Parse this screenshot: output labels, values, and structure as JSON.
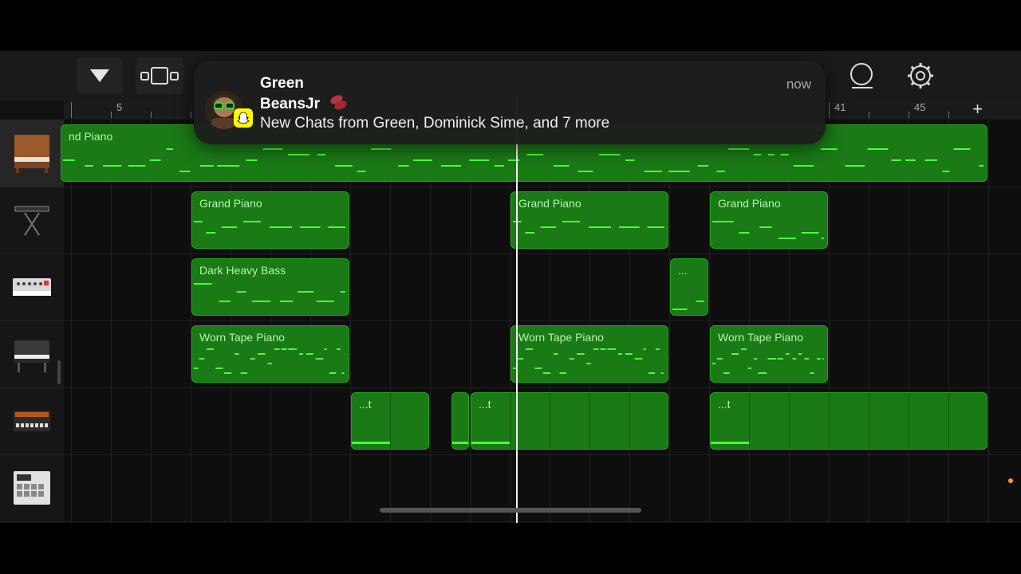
{
  "notification": {
    "sender_line1": "Green",
    "sender_line2": "BeansJr",
    "body": "New Chats from Green, Dominick Sime, and 7 more",
    "time": "now",
    "app_icon": "snapchat-ghost-icon",
    "badge_color": "#fffc00"
  },
  "toolbar": {
    "tracks_menu_icon": "triangle-down-icon",
    "view_toggle_icon": "tracks-view-icon",
    "loop_icon": "loop-icon",
    "settings_icon": "gear-icon"
  },
  "ruler": {
    "bar_labels": [
      "5",
      "41",
      "45"
    ],
    "add_label": "+"
  },
  "tracks": [
    {
      "instrument_icon": "upright-piano-icon",
      "regions": [
        {
          "label": "nd Piano"
        }
      ]
    },
    {
      "instrument_icon": "keyboard-stand-icon",
      "regions": [
        {
          "label": "Grand Piano"
        },
        {
          "label": "Grand Piano"
        },
        {
          "label": "Grand Piano"
        }
      ]
    },
    {
      "instrument_icon": "synth-module-icon",
      "regions": [
        {
          "label": "Dark Heavy Bass"
        },
        {
          "label": "..."
        }
      ]
    },
    {
      "instrument_icon": "electric-piano-icon",
      "regions": [
        {
          "label": "Worn Tape Piano"
        },
        {
          "label": "Worn Tape Piano"
        },
        {
          "label": "Worn Tape Piano"
        }
      ]
    },
    {
      "instrument_icon": "drum-machine-icon",
      "regions": [
        {
          "label": "...t"
        },
        {
          "label": ""
        },
        {
          "label": "...t"
        },
        {
          "label": "...t"
        }
      ]
    },
    {
      "instrument_icon": "sampler-pad-icon",
      "regions": []
    }
  ],
  "colors": {
    "region_fill": "#1a7a16",
    "region_border": "#23a41d",
    "note": "#4cff3c",
    "label": "#b6f5a8",
    "playhead": "#f3f3f3",
    "accent_dot": "#ff9a1a"
  }
}
